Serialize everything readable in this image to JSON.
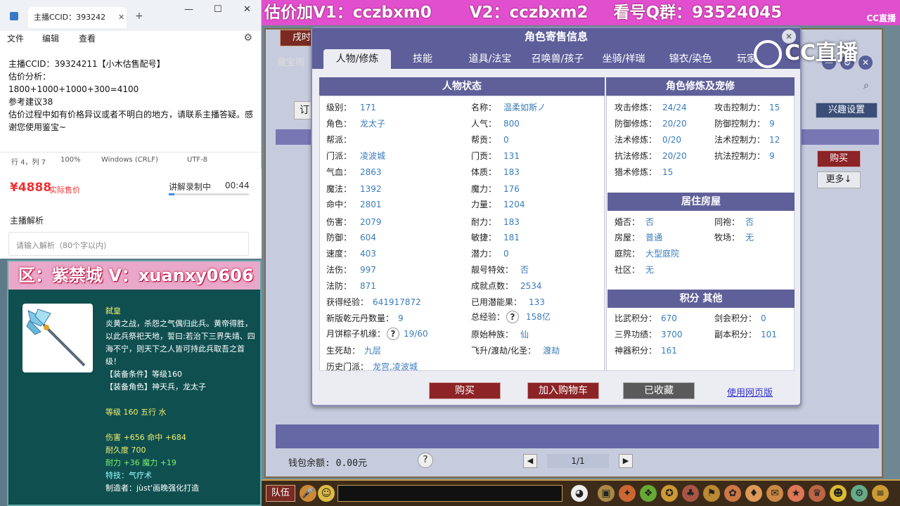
{
  "notepad": {
    "tab_title": "主播CCID：393242",
    "tab_close": "✕",
    "tab_add": "+",
    "win_min": "—",
    "win_max": "☐",
    "win_close": "✕",
    "menu": [
      "文件",
      "编辑",
      "查看"
    ],
    "lines": [
      "主播CCID：39324211【小木估售配号】",
      "估价分析：",
      "1800+1000+1000+300=4100",
      "参考建议38",
      "估价过程中如有价格异议或者不明白的地方，请联系主播答疑。感谢您使用鉴宝~"
    ],
    "status": {
      "pos": "行 4，列 7",
      "zoom": "100%",
      "eol": "Windows (CRLF)",
      "enc": "UTF-8"
    }
  },
  "price_panel": {
    "price": "¥4888",
    "price_label": "实际售价",
    "recording_label": "讲解录制中",
    "recording_time": "00:44",
    "recording_progress": 0.07,
    "analysis_title": "主播解析",
    "analysis_placeholder": "请输入解析（80个字以内）"
  },
  "item_panel": {
    "banner": "区：紫禁城 V：xuanxy0606",
    "lines": [
      {
        "t": "弑皇",
        "c": "it-yellow"
      },
      {
        "t": "炎黄之战，杀怨之气偶归此兵。黄帝得胜，以此兵祭祀天地，誓曰:若治下三界失靖、四海不宁，则天下之人皆可持此兵取吾之首级！",
        "c": "it-white"
      },
      {
        "t": "【装备条件】等级160",
        "c": "it-white"
      },
      {
        "t": "【装备角色】神天兵，龙太子",
        "c": "it-white"
      },
      {
        "t": "",
        "c": "it-white"
      },
      {
        "t": "等级 160 五行 水",
        "c": "it-yellow"
      },
      {
        "t": "",
        "c": "it-white"
      },
      {
        "t": "伤害 +656 命中 +684",
        "c": "it-yellow"
      },
      {
        "t": "耐久度 700",
        "c": "it-yellow"
      },
      {
        "t": "耐力 +36 魔力 +19",
        "c": "it-green"
      },
      {
        "t": "特技：气疗术",
        "c": "it-cyan"
      },
      {
        "t": "制造者：jùst'画晚强化打造",
        "c": "it-white"
      }
    ]
  },
  "top_banner": {
    "text1": "估价加V1：cczbxm0",
    "text2": "V2：cczbxm2",
    "text3": "看号Q群：93524045",
    "cc": "CC直播"
  },
  "game": {
    "tab_xushi": "戌时",
    "tab_cangbao": "藏宝阁",
    "order_btn": "订",
    "xingqu": "兴趣设置",
    "buy_side": "购买",
    "more_side": "更多↓",
    "wallet": "钱包余额: 0.00元",
    "page": "1/1",
    "team": "队伍"
  },
  "dialog": {
    "title": "角色寄售信息",
    "tabs": [
      "人物/修炼",
      "技能",
      "道具/法宝",
      "召唤兽/孩子",
      "坐骑/祥瑞",
      "锦衣/染色",
      "玩家"
    ],
    "status_header": "人物状态",
    "xiulian_header": "角色修炼及宠修",
    "house_header": "居住房屋",
    "score_header": "积分 其他",
    "status_left": [
      {
        "k": "级别：",
        "v": "171"
      },
      {
        "k": "角色：",
        "v": "龙太子"
      },
      {
        "k": "帮派：",
        "v": ""
      },
      {
        "k": "门派：",
        "v": "凌波城"
      },
      {
        "k": "气血：",
        "v": "2863"
      },
      {
        "k": "魔法：",
        "v": "1392"
      },
      {
        "k": "命中：",
        "v": "2801"
      },
      {
        "k": "伤害：",
        "v": "2079"
      },
      {
        "k": "防御：",
        "v": "604"
      },
      {
        "k": "速度：",
        "v": "403"
      },
      {
        "k": "法伤：",
        "v": "997"
      },
      {
        "k": "法防：",
        "v": "871"
      },
      {
        "k": "获得经验：",
        "v": "641917872"
      },
      {
        "k": "新版乾元丹数量：",
        "v": "9"
      },
      {
        "k": "月饼粽子机缘：",
        "v": "19/60"
      },
      {
        "k": "生死劫：",
        "v": "九层"
      },
      {
        "k": "历史门派：",
        "v": "龙宫,凌波城"
      }
    ],
    "status_right": [
      {
        "k": "名称：",
        "v": "温柔如斯ノ"
      },
      {
        "k": "人气：",
        "v": "800"
      },
      {
        "k": "帮贡：",
        "v": "0"
      },
      {
        "k": "门贡：",
        "v": "131"
      },
      {
        "k": "体质：",
        "v": "183"
      },
      {
        "k": "魔力：",
        "v": "176"
      },
      {
        "k": "力量：",
        "v": "1204"
      },
      {
        "k": "耐力：",
        "v": "183"
      },
      {
        "k": "敏捷：",
        "v": "181"
      },
      {
        "k": "潜力：",
        "v": "0"
      },
      {
        "k": "靓号特效：",
        "v": "否"
      },
      {
        "k": "成就点数：",
        "v": "2534"
      },
      {
        "k": "已用潜能果：",
        "v": "133"
      },
      {
        "k": "总经验：",
        "v": "158亿"
      },
      {
        "k": "原始种族：",
        "v": "仙"
      },
      {
        "k": "飞升/渡劫/化圣：",
        "v": "渡劫"
      }
    ],
    "question_mark": "?",
    "xiulian": [
      {
        "k": "攻击修炼：",
        "v": "24/24"
      },
      {
        "k": "防御修炼：",
        "v": "20/20"
      },
      {
        "k": "法术修炼：",
        "v": "0/20"
      },
      {
        "k": "抗法修炼：",
        "v": "20/20"
      },
      {
        "k": "猎术修炼：",
        "v": "15"
      }
    ],
    "kongzhi": [
      {
        "k": "攻击控制力：",
        "v": "15"
      },
      {
        "k": "防御控制力：",
        "v": "9"
      },
      {
        "k": "法术控制力：",
        "v": "12"
      },
      {
        "k": "抗法控制力：",
        "v": "9"
      }
    ],
    "house_left": [
      {
        "k": "婚否：",
        "v": "否"
      },
      {
        "k": "房屋：",
        "v": "普通"
      },
      {
        "k": "庭院：",
        "v": "大型庭院"
      },
      {
        "k": "社区：",
        "v": "无"
      }
    ],
    "house_right": [
      {
        "k": "同袍：",
        "v": "否"
      },
      {
        "k": "牧场：",
        "v": "无"
      }
    ],
    "score_left": [
      {
        "k": "比武积分：",
        "v": "670"
      },
      {
        "k": "三界功绩：",
        "v": "3700"
      },
      {
        "k": "神器积分：",
        "v": "161"
      }
    ],
    "score_right": [
      {
        "k": "剑会积分：",
        "v": "0"
      },
      {
        "k": "副本积分：",
        "v": "101"
      }
    ],
    "btn_buy": "购买",
    "btn_cart": "加入购物车",
    "btn_fav": "已收藏",
    "web_link": "使用网页版",
    "close": "✕"
  },
  "cc_logo": "CC直播"
}
